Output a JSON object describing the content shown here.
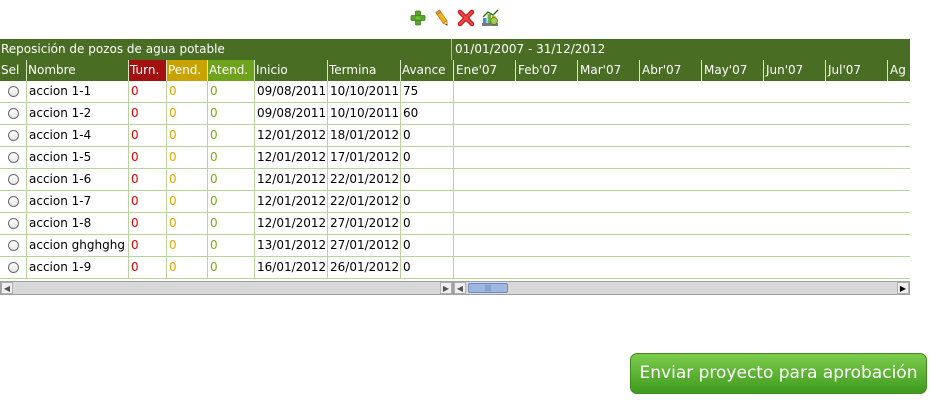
{
  "toolbar": {
    "icons": [
      "add-icon",
      "edit-icon",
      "delete-icon",
      "chart-icon"
    ]
  },
  "grid": {
    "title": "Reposición de pozos de agua potable",
    "period": "01/01/2007 - 31/12/2012",
    "headers": {
      "sel": "Sel",
      "nombre": "Nombre",
      "turn": "Turn.",
      "pend": "Pend.",
      "atend": "Atend.",
      "inicio": "Inicio",
      "termina": "Termina",
      "avance": "Avance"
    },
    "months": [
      "Ene'07",
      "Feb'07",
      "Mar'07",
      "Abr'07",
      "May'07",
      "Jun'07",
      "Jul'07",
      "Ag"
    ],
    "rows": [
      {
        "nombre": "accion 1-1",
        "turn": "0",
        "pend": "0",
        "atend": "0",
        "inicio": "09/08/2011",
        "termina": "10/10/2011",
        "avance": "75"
      },
      {
        "nombre": "accion 1-2",
        "turn": "0",
        "pend": "0",
        "atend": "0",
        "inicio": "09/08/2011",
        "termina": "10/10/2011",
        "avance": "60"
      },
      {
        "nombre": "accion 1-4",
        "turn": "0",
        "pend": "0",
        "atend": "0",
        "inicio": "12/01/2012",
        "termina": "18/01/2012",
        "avance": "0"
      },
      {
        "nombre": "accion 1-5",
        "turn": "0",
        "pend": "0",
        "atend": "0",
        "inicio": "12/01/2012",
        "termina": "17/01/2012",
        "avance": "0"
      },
      {
        "nombre": "accion 1-6",
        "turn": "0",
        "pend": "0",
        "atend": "0",
        "inicio": "12/01/2012",
        "termina": "22/01/2012",
        "avance": "0"
      },
      {
        "nombre": "accion 1-7",
        "turn": "0",
        "pend": "0",
        "atend": "0",
        "inicio": "12/01/2012",
        "termina": "22/01/2012",
        "avance": "0"
      },
      {
        "nombre": "accion 1-8",
        "turn": "0",
        "pend": "0",
        "atend": "0",
        "inicio": "12/01/2012",
        "termina": "27/01/2012",
        "avance": "0"
      },
      {
        "nombre": "accion ghghghg",
        "turn": "0",
        "pend": "0",
        "atend": "0",
        "inicio": "13/01/2012",
        "termina": "27/01/2012",
        "avance": "0"
      },
      {
        "nombre": "accion 1-9",
        "turn": "0",
        "pend": "0",
        "atend": "0",
        "inicio": "16/01/2012",
        "termina": "26/01/2012",
        "avance": "0"
      }
    ]
  },
  "submit_label": "Enviar proyecto para aprobación",
  "colors": {
    "header_green": "#4a6d24",
    "turn_red": "#a40f0f",
    "pend_yellow": "#c9a300",
    "atend_green": "#6ea31b",
    "button_green": "#5fb535"
  }
}
